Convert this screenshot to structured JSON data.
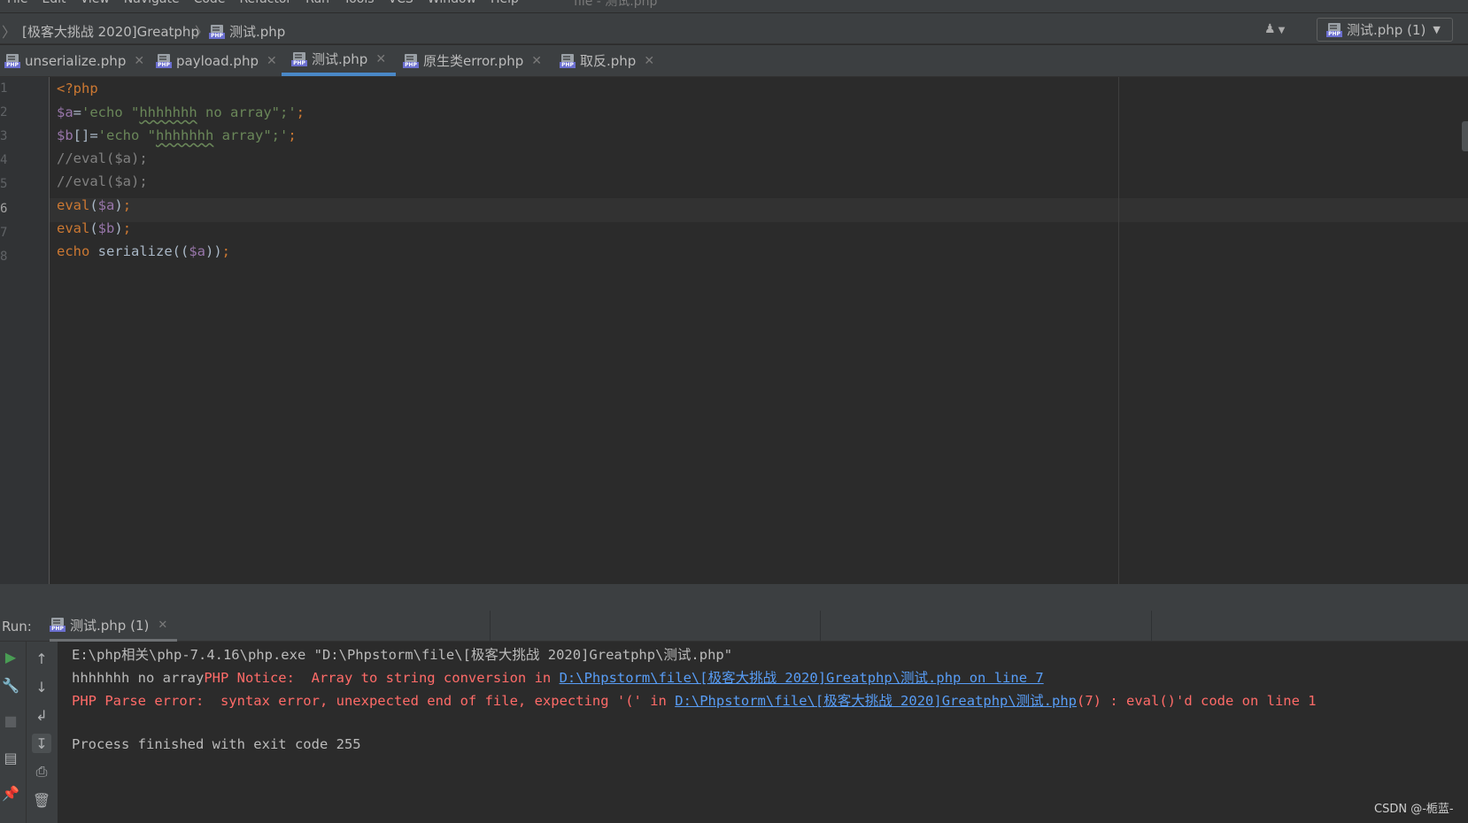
{
  "menu": {
    "items": [
      "File",
      "Edit",
      "View",
      "Navigate",
      "Code",
      "Refactor",
      "Run",
      "Tools",
      "VCS",
      "Window",
      "Help"
    ],
    "title": "file - 测试.php"
  },
  "breadcrumb": {
    "project": "[极客大挑战 2020]Greatphp",
    "file": "测试.php"
  },
  "run_config": {
    "label": "测试.php (1)"
  },
  "tabs": [
    {
      "label": "unserialize.php",
      "active": false
    },
    {
      "label": "payload.php",
      "active": false
    },
    {
      "label": "测试.php",
      "active": true
    },
    {
      "label": "原生类error.php",
      "active": false
    },
    {
      "label": "取反.php",
      "active": false
    }
  ],
  "editor": {
    "line_numbers": [
      "1",
      "2",
      "3",
      "4",
      "5",
      "6",
      "7",
      "8"
    ],
    "current_line": "6",
    "lines": [
      {
        "tokens": [
          {
            "t": "<?php",
            "c": "tag"
          }
        ]
      },
      {
        "tokens": [
          {
            "t": "$a",
            "c": "var"
          },
          {
            "t": "=",
            "c": "op"
          },
          {
            "t": "'echo \"",
            "c": "str"
          },
          {
            "t": "hhhhhhh",
            "c": "typo"
          },
          {
            "t": " no array\";'",
            "c": "str"
          },
          {
            "t": ";",
            "c": "kw"
          }
        ]
      },
      {
        "tokens": [
          {
            "t": "$b",
            "c": "var"
          },
          {
            "t": "[]=",
            "c": "op"
          },
          {
            "t": "'echo \"",
            "c": "str"
          },
          {
            "t": "hhhhhhh",
            "c": "typo"
          },
          {
            "t": " array\";'",
            "c": "str"
          },
          {
            "t": ";",
            "c": "kw"
          }
        ]
      },
      {
        "tokens": [
          {
            "t": "//eval($a);",
            "c": "cmt"
          }
        ]
      },
      {
        "tokens": [
          {
            "t": "//eval($a);",
            "c": "cmt"
          }
        ]
      },
      {
        "tokens": [
          {
            "t": "eval",
            "c": "kw"
          },
          {
            "t": "(",
            "c": "op"
          },
          {
            "t": "$a",
            "c": "var"
          },
          {
            "t": ")",
            "c": "op"
          },
          {
            "t": ";",
            "c": "kw"
          }
        ]
      },
      {
        "tokens": [
          {
            "t": "eval",
            "c": "kw"
          },
          {
            "t": "(",
            "c": "op"
          },
          {
            "t": "$b",
            "c": "var"
          },
          {
            "t": ")",
            "c": "op"
          },
          {
            "t": ";",
            "c": "kw"
          }
        ]
      },
      {
        "tokens": [
          {
            "t": "echo",
            "c": "kw"
          },
          {
            "t": " serialize((",
            "c": "op"
          },
          {
            "t": "$a",
            "c": "var"
          },
          {
            "t": "))",
            "c": "op"
          },
          {
            "t": ";",
            "c": "kw"
          }
        ]
      }
    ]
  },
  "run": {
    "label": "Run:",
    "tab_label": "测试.php (1)",
    "console": [
      [
        {
          "t": "E:\\php相关\\php-7.4.16\\php.exe \"D:\\Phpstorm\\file\\[极客大挑战 2020]Greatphp\\测试.php\"",
          "c": "normal"
        }
      ],
      [
        {
          "t": "hhhhhhh no array",
          "c": "normal"
        },
        {
          "t": "PHP Notice:  Array to string conversion in ",
          "c": "err"
        },
        {
          "t": "D:\\Phpstorm\\file\\[极客大挑战 2020]Greatphp\\测试.php on line 7",
          "c": "link"
        }
      ],
      [
        {
          "t": "PHP Parse error:  syntax error, unexpected end of file, expecting '(' in ",
          "c": "err"
        },
        {
          "t": "D:\\Phpstorm\\file\\[极客大挑战 2020]Greatphp\\测试.php",
          "c": "link"
        },
        {
          "t": "(7) : eval()'d code on line 1",
          "c": "err"
        }
      ],
      [],
      [
        {
          "t": "Process finished with exit code 255",
          "c": "normal"
        }
      ]
    ]
  },
  "watermark": "CSDN @-栀蓝-",
  "colors": {
    "background": "#2b2b2b",
    "panel": "#3c3f41",
    "accent": "#4a88c7",
    "keyword": "#cc7832",
    "variable": "#9876aa",
    "string": "#6a8759",
    "comment": "#808080",
    "error": "#ff6b68",
    "link": "#589df6"
  }
}
